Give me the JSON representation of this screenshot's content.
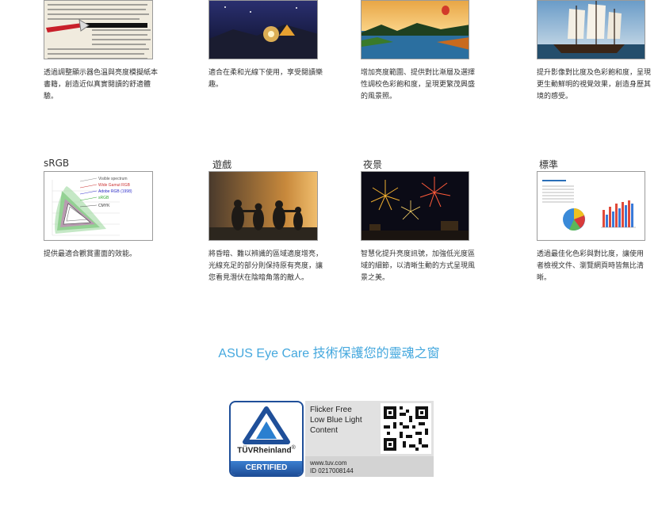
{
  "top_row": [
    {
      "id": "reading",
      "caption": "透過調整顯示器色溫與亮度模擬紙本書籍，創造近似真實閱讀的舒適體驗。"
    },
    {
      "id": "darkroom",
      "caption": "適合在柔和光線下使用，享受閱讀樂趣。"
    },
    {
      "id": "scenery",
      "caption": "增加亮度範圍、提供對比漸層及選擇性調校色彩飽和度，呈現更繁茂興盛的風景照。"
    },
    {
      "id": "theater",
      "caption": "提升影像對比度及色彩飽和度，呈現更生動鮮明的視覺效果，創造身歷其境的感受。"
    }
  ],
  "modes": [
    {
      "id": "srgb",
      "title": "sRGB",
      "caption": "提供最適合觀賞畫面的效能。",
      "legend": [
        "Visible spectrum",
        "Wide Gamut RGB",
        "Adobe RGB (1998)",
        "sRGB",
        "CMYK"
      ]
    },
    {
      "id": "game",
      "title": "遊戲",
      "caption": "將昏暗、難以辨識的區域適度增亮，光線充足的部分則保持原有亮度，讓您看見潛伏在陰暗角落的敵人。"
    },
    {
      "id": "night",
      "title": "夜景",
      "caption": "智慧化提升亮度訊號，加強低光度區域的細節，以清晰生動的方式呈現風景之美。"
    },
    {
      "id": "standard",
      "title": "標準",
      "caption": "透過最佳化色彩與對比度，讓使用者檢視文件、瀏覽網頁時皆無比清晰。"
    }
  ],
  "headline": "ASUS Eye Care 技術保護您的靈魂之窗",
  "tuv": {
    "brand": "TÜVRheinland",
    "registered": "®",
    "certified": "CERTIFIED",
    "features": [
      "Flicker Free",
      "Low Blue Light",
      "Content"
    ],
    "url": "www.tuv.com",
    "id_text": "ID  0217008144"
  },
  "colors": {
    "accent": "#45a8de",
    "tuv_blue": "#1f4f99"
  }
}
